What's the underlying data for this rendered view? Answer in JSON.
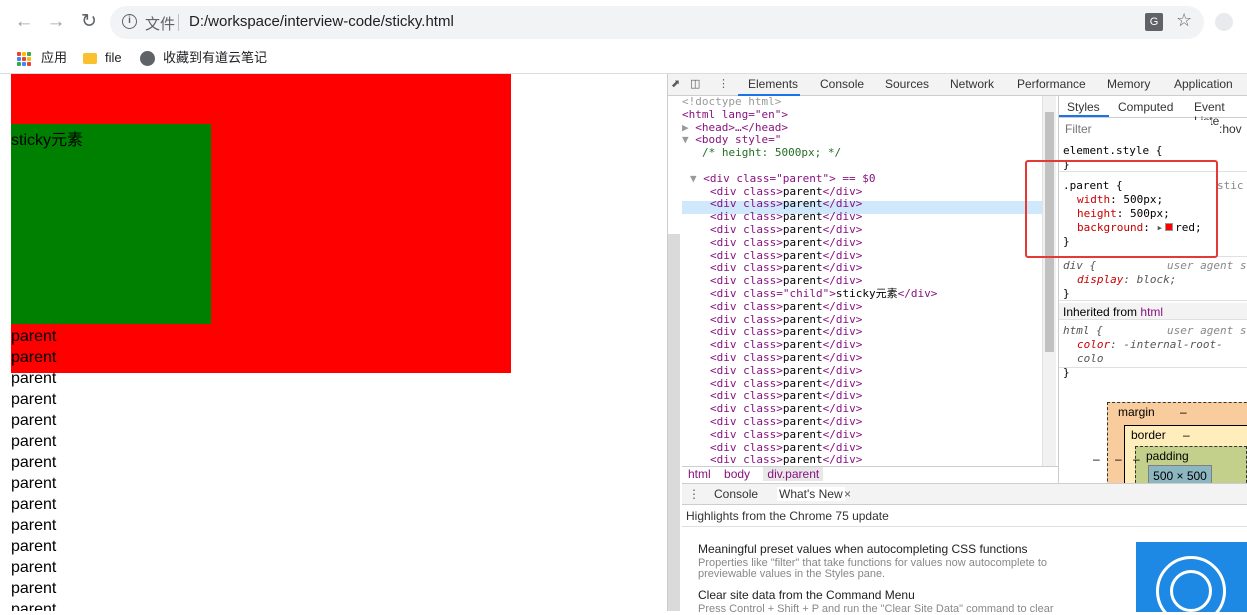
{
  "browser": {
    "scheme_label": "文件",
    "url": "D:/workspace/interview-code/sticky.html",
    "bookmarks": [
      {
        "label": "应用"
      },
      {
        "label": "file"
      },
      {
        "label": "收藏到有道云笔记"
      }
    ],
    "colors": {
      "apps": [
        "#ea4335",
        "#fbbc05",
        "#34a853",
        "#4285f4",
        "#ea4335",
        "#fbbc05",
        "#34a853",
        "#4285f4",
        "#ea4335"
      ]
    }
  },
  "page": {
    "child_text": "sticky元素",
    "parent_lines": [
      "parent",
      "parent",
      "parent",
      "parent",
      "parent",
      "parent",
      "parent",
      "parent",
      "parent",
      "parent",
      "parent",
      "parent",
      "parent",
      "parent"
    ],
    "colors": {
      "parent": "#ff0000",
      "child": "#008000"
    }
  },
  "devtools": {
    "tabs": [
      "Elements",
      "Console",
      "Sources",
      "Network",
      "Performance",
      "Memory",
      "Application"
    ],
    "dom": {
      "doctype": "<!doctype html>",
      "html_open": "<html lang=\"en\">",
      "head": "<head>…</head>",
      "body_open": "<body style=\"",
      "body_comment": "/* height: 5000px; */",
      "body_close": "\">",
      "selected": "<div class=\"parent\"> == $0",
      "child_row": "<div class=\"child\">sticky元素</div>",
      "parent_row": "<div class>parent</div>",
      "rows_before_child": 8,
      "rows_after_child": 14
    },
    "breadcrumb": [
      "html",
      "body",
      "div.parent"
    ],
    "styles": {
      "tabs": [
        "Styles",
        "Computed",
        "Event Liste"
      ],
      "filter_placeholder": "Filter",
      "hov": ":hov",
      "element_style": "element.style {",
      "close_brace": "}",
      "parent_selector": ".parent {",
      "parent_source": "stic",
      "props": [
        {
          "name": "width",
          "value": "500px;"
        },
        {
          "name": "height",
          "value": "500px;"
        },
        {
          "name": "background",
          "value": "red;"
        }
      ],
      "div_selector": "div {",
      "ua_label": "user agent s",
      "div_prop": {
        "name": "display",
        "value": "block;"
      },
      "inherited_label": "Inherited from",
      "inherited_tag": "html",
      "html_selector": "html {",
      "html_prop": {
        "name": "color",
        "value": "-internal-root-colo"
      },
      "box_model": {
        "margin": "margin",
        "border": "border",
        "padding": "padding",
        "content": "500 × 500",
        "dash": "–"
      }
    },
    "drawer": {
      "tabs": [
        "Console",
        "What's New"
      ],
      "heading": "Highlights from the Chrome 75 update",
      "items": [
        {
          "title": "Meaningful preset values when autocompleting CSS functions",
          "body": "Properties like \"filter\" that take functions for values now autocomplete to previewable values in the Styles pane."
        },
        {
          "title": "Clear site data from the Command Menu",
          "body": "Press Control + Shift + P and run the \"Clear Site Data\" command to clear"
        }
      ]
    }
  }
}
